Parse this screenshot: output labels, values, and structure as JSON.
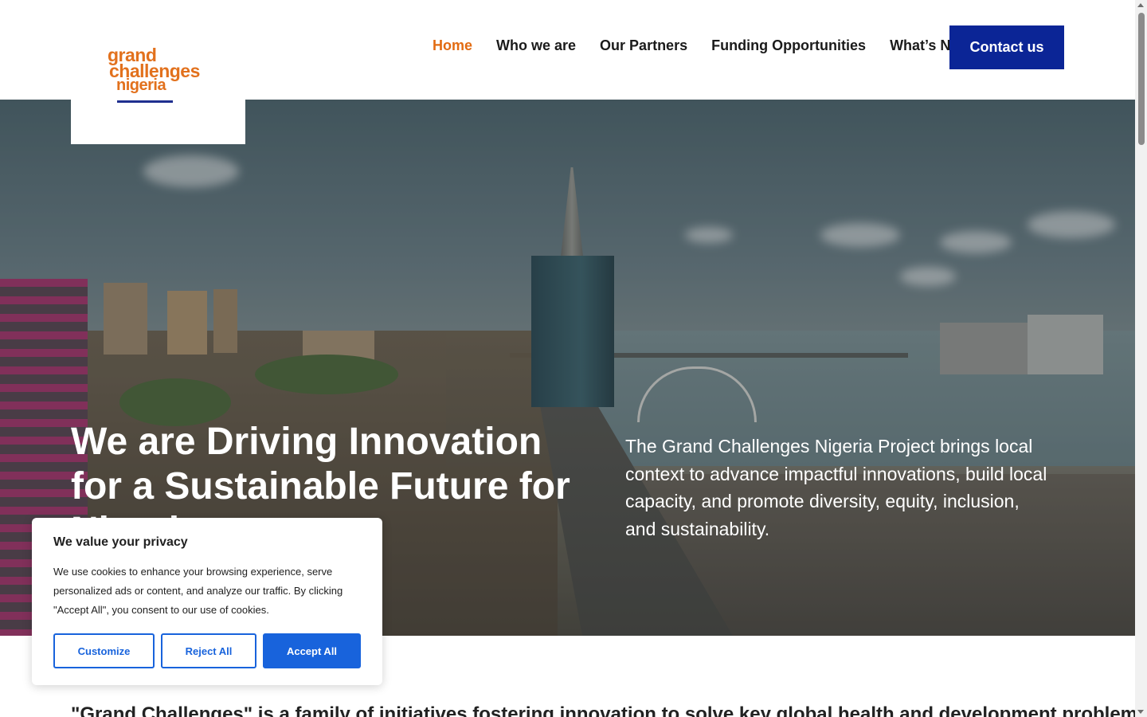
{
  "header": {
    "logo": {
      "line1": "grand",
      "line2": "challenges",
      "line3": "nigeria"
    },
    "nav": [
      {
        "label": "Home",
        "active": true
      },
      {
        "label": "Who we are",
        "active": false
      },
      {
        "label": "Our Partners",
        "active": false
      },
      {
        "label": "Funding Opportunities",
        "active": false
      },
      {
        "label": "What’s New",
        "active": false
      }
    ],
    "contact_label": "Contact us"
  },
  "hero": {
    "title": "We are Driving Innovation for a Sustainable Future for Nigeria",
    "description": "The Grand Challenges Nigeria Project brings local context to advance impactful innovations, build local capacity, and promote diversity, equity, inclusion, and sustainability."
  },
  "intro": {
    "text": "\"Grand Challenges\" is a family of initiatives fostering innovation to solve key global health and development problems"
  },
  "cookie_banner": {
    "title": "We value your privacy",
    "text": "We use cookies to enhance your browsing experience, serve personalized ads or content, and analyze our traffic. By clicking \"Accept All\", you consent to our use of cookies.",
    "customize_label": "Customize",
    "reject_label": "Reject All",
    "accept_label": "Accept All"
  },
  "colors": {
    "accent_orange": "#e26b12",
    "brand_blue": "#0b2596",
    "cookie_blue": "#1863dc"
  }
}
